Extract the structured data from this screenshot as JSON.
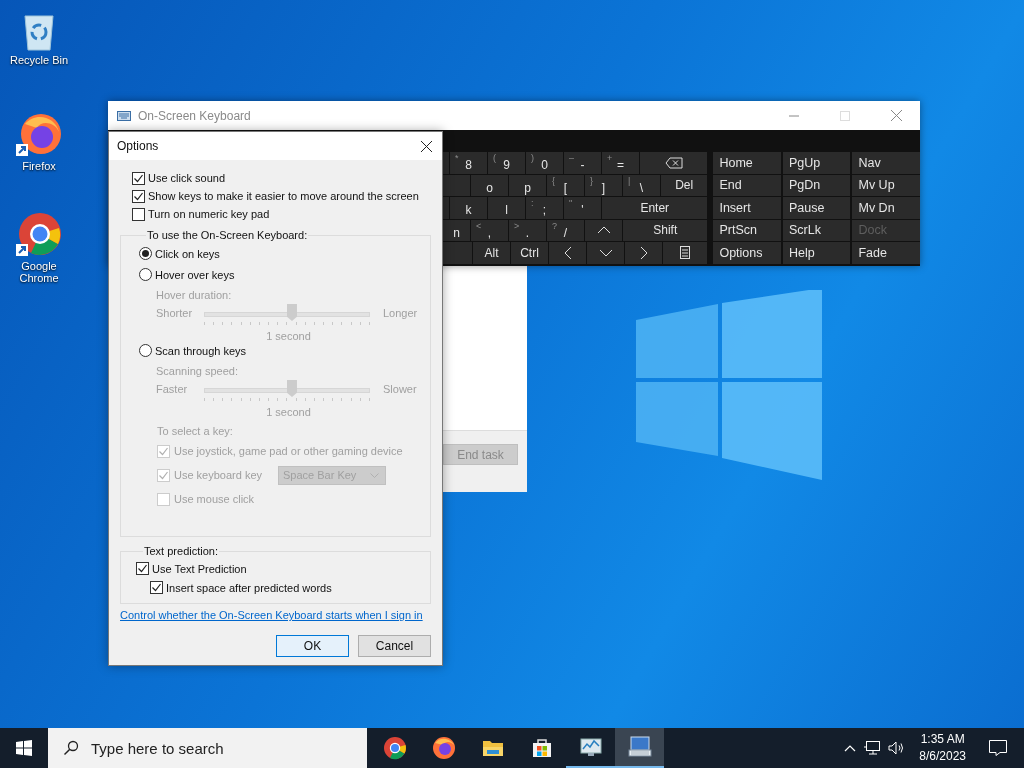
{
  "desktop_icons": [
    {
      "kind": "bin",
      "label": "Recycle Bin"
    },
    {
      "kind": "firefox",
      "label": "Firefox"
    },
    {
      "kind": "chrome",
      "label": "Google Chrome"
    }
  ],
  "task_manager": {
    "end_task": {
      "label": "End task",
      "disabled": true
    }
  },
  "keyboard_window": {
    "title": "On-Screen Keyboard",
    "rows": [
      [
        {
          "kind": "char",
          "main": "8",
          "shift": "*"
        },
        {
          "kind": "char",
          "main": "9",
          "shift": "("
        },
        {
          "kind": "char",
          "main": "0",
          "shift": ")"
        },
        {
          "kind": "char",
          "main": "-",
          "shift": "–"
        },
        {
          "kind": "char",
          "main": "=",
          "shift": "+"
        },
        {
          "kind": "backspace"
        }
      ],
      [
        {
          "kind": "char",
          "main": "o"
        },
        {
          "kind": "char",
          "main": "p"
        },
        {
          "kind": "char",
          "main": "[",
          "shift": "{"
        },
        {
          "kind": "char",
          "main": "]",
          "shift": "}"
        },
        {
          "kind": "char",
          "main": "\\",
          "shift": "|"
        },
        {
          "kind": "text",
          "main": "Del"
        }
      ],
      [
        {
          "kind": "char",
          "main": "k"
        },
        {
          "kind": "char",
          "main": "l"
        },
        {
          "kind": "char",
          "main": ";",
          "shift": ":"
        },
        {
          "kind": "char",
          "main": "'",
          "shift": "\""
        },
        {
          "kind": "text",
          "main": "Enter"
        }
      ],
      [
        {
          "kind": "char",
          "main": "n"
        },
        {
          "kind": "char",
          "main": ",",
          "shift": "<"
        },
        {
          "kind": "char",
          "main": ".",
          "shift": ">"
        },
        {
          "kind": "char",
          "main": "/",
          "shift": "?"
        },
        {
          "kind": "up"
        },
        {
          "kind": "text",
          "main": "Shift"
        }
      ],
      [
        {
          "kind": "text",
          "main": "Alt"
        },
        {
          "kind": "text",
          "main": "Ctrl"
        },
        {
          "kind": "left"
        },
        {
          "kind": "down"
        },
        {
          "kind": "right"
        },
        {
          "kind": "menu"
        }
      ]
    ],
    "nav_keys": [
      [
        {
          "label": "Home",
          "disabled": false
        },
        {
          "label": "PgUp",
          "disabled": false
        },
        {
          "label": "Nav",
          "disabled": false
        }
      ],
      [
        {
          "label": "End",
          "disabled": false
        },
        {
          "label": "PgDn",
          "disabled": false
        },
        {
          "label": "Mv Up",
          "disabled": false
        }
      ],
      [
        {
          "label": "Insert",
          "disabled": false
        },
        {
          "label": "Pause",
          "disabled": false
        },
        {
          "label": "Mv Dn",
          "disabled": false
        }
      ],
      [
        {
          "label": "PrtScn",
          "disabled": false
        },
        {
          "label": "ScrLk",
          "disabled": false
        },
        {
          "label": "Dock",
          "disabled": true
        }
      ],
      [
        {
          "label": "Options",
          "disabled": false
        },
        {
          "label": "Help",
          "disabled": false
        },
        {
          "label": "Fade",
          "disabled": false
        }
      ]
    ]
  },
  "options_dialog": {
    "title": "Options",
    "checks": [
      {
        "label": "Use click sound",
        "checked": true
      },
      {
        "label": "Show keys to make it easier to move around the screen",
        "checked": true
      },
      {
        "label": "Turn on numeric key pad",
        "checked": false
      }
    ],
    "use_group": {
      "title": "To use the On-Screen Keyboard:",
      "modes": [
        {
          "label": "Click on keys",
          "selected": true
        },
        {
          "label": "Hover over keys",
          "selected": false,
          "slider": {
            "caption": "Hover duration:",
            "min_label": "Shorter",
            "max_label": "Longer",
            "level": 0.53,
            "reading": "1 second",
            "disabled": true
          }
        },
        {
          "label": "Scan through keys",
          "selected": false,
          "slider": {
            "caption": "Scanning speed:",
            "min_label": "Faster",
            "max_label": "Slower",
            "level": 0.53,
            "reading": "1 second",
            "disabled": true
          }
        }
      ],
      "select_key": {
        "caption": "To select a key:",
        "disabled": true,
        "options": [
          {
            "label": "Use joystick, game pad or other gaming device",
            "checked": true
          },
          {
            "label": "Use keyboard key",
            "checked": true,
            "dropdown": "Space Bar Key"
          },
          {
            "label": "Use mouse click",
            "checked": false
          }
        ]
      }
    },
    "text_prediction": {
      "title": "Text prediction:",
      "options": [
        {
          "label": "Use Text Prediction",
          "checked": true,
          "children": [
            {
              "label": "Insert space after predicted words",
              "checked": true
            }
          ]
        }
      ]
    },
    "link": "Control whether the On-Screen Keyboard starts when I sign in",
    "buttons": [
      {
        "label": "OK",
        "default": true
      },
      {
        "label": "Cancel",
        "default": false
      }
    ]
  },
  "taskbar": {
    "search_placeholder": "Type here to search",
    "apps": [
      {
        "kind": "chrome",
        "running": false,
        "active": false
      },
      {
        "kind": "firefox",
        "running": false,
        "active": false
      },
      {
        "kind": "folder",
        "running": false,
        "active": false
      },
      {
        "kind": "store",
        "running": false,
        "active": false
      },
      {
        "kind": "taskmgr",
        "running": true,
        "active": false
      },
      {
        "kind": "osk",
        "running": true,
        "active": true
      }
    ],
    "time": "1:35 AM",
    "date": "8/6/2023"
  }
}
